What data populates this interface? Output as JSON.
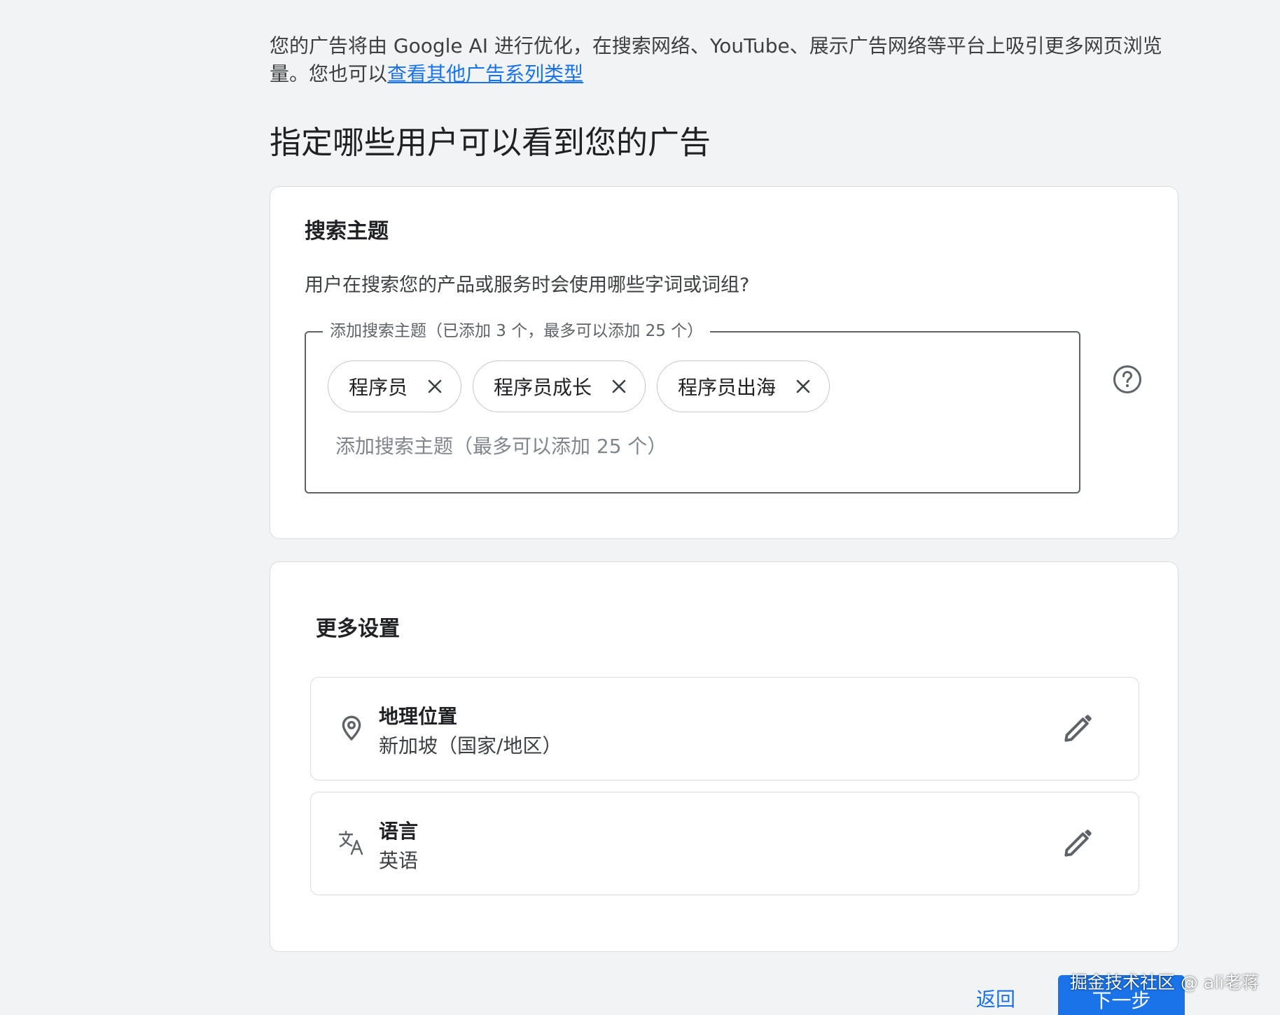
{
  "intro": {
    "text": "您的广告将由 Google AI 进行优化，在搜索网络、YouTube、展示广告网络等平台上吸引更多网页浏览量。您也可以",
    "link_text": "查看其他广告系列类型"
  },
  "page_title": "指定哪些用户可以看到您的广告",
  "search_topics": {
    "title": "搜索主题",
    "question": "用户在搜索您的产品或服务时会使用哪些字词或词组?",
    "field_label": "添加搜索主题（已添加 3 个，最多可以添加 25 个）",
    "chips": [
      {
        "label": "程序员"
      },
      {
        "label": "程序员成长"
      },
      {
        "label": "程序员出海"
      }
    ],
    "input_placeholder": "添加搜索主题（最多可以添加 25 个）",
    "help_icon": "help-circle-icon"
  },
  "more_settings": {
    "title": "更多设置",
    "rows": [
      {
        "icon": "location-pin-icon",
        "title": "地理位置",
        "value": "新加坡（国家/地区）"
      },
      {
        "icon": "translate-icon",
        "title": "语言",
        "value": "英语"
      }
    ]
  },
  "footer": {
    "back_label": "返回",
    "next_label": "下一步"
  },
  "watermark": "掘金技术社区 @ ali老蒋",
  "colors": {
    "background": "#f1f3f4",
    "accent": "#1a73e8",
    "card_border": "#dadce0"
  }
}
